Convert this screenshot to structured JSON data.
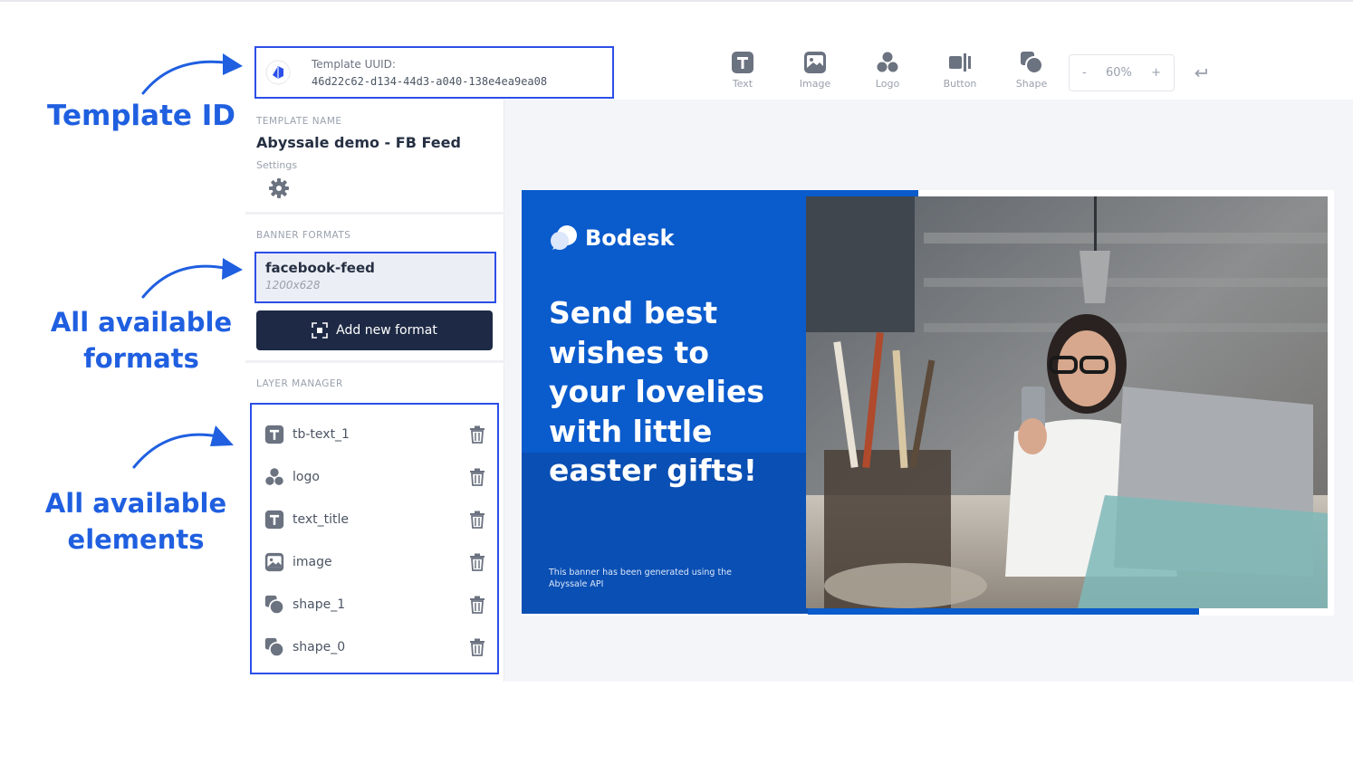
{
  "annotations": {
    "template_id": "Template ID",
    "formats_line1": "All available",
    "formats_line2": "formats",
    "elements_line1": "All available",
    "elements_line2": "elements"
  },
  "uuid": {
    "label": "Template UUID:",
    "value": "46d22c62-d134-44d3-a040-138e4ea9ea08"
  },
  "toolbar": {
    "items": [
      {
        "label": "Text",
        "icon": "text-icon"
      },
      {
        "label": "Image",
        "icon": "image-icon"
      },
      {
        "label": "Logo",
        "icon": "logo-icon"
      },
      {
        "label": "Button",
        "icon": "button-icon"
      },
      {
        "label": "Shape",
        "icon": "shape-icon"
      }
    ],
    "zoom": {
      "minus": "-",
      "value": "60%",
      "plus": "+"
    },
    "undo_icon": "undo-icon"
  },
  "sidebar": {
    "template_name_label": "TEMPLATE NAME",
    "template_name": "Abyssale demo - FB Feed",
    "settings_label": "Settings",
    "banner_formats_label": "BANNER FORMATS",
    "format": {
      "name": "facebook-feed",
      "size": "1200x628"
    },
    "add_format_label": "Add new format",
    "layer_manager_label": "LAYER MANAGER",
    "layers": [
      {
        "name": "tb-text_1",
        "icon": "text-icon"
      },
      {
        "name": "logo",
        "icon": "logo-icon"
      },
      {
        "name": "text_title",
        "icon": "text-icon"
      },
      {
        "name": "image",
        "icon": "image-icon"
      },
      {
        "name": "shape_1",
        "icon": "shape-icon"
      },
      {
        "name": "shape_0",
        "icon": "shape-icon"
      }
    ]
  },
  "banner": {
    "brand": "Bodesk",
    "headline": "Send best wishes to your lovelies with little easter gifts!",
    "footnote": "This banner has been generated using the Abyssale API",
    "colors": {
      "primary": "#0a5bcc",
      "dark": "#0a4fb3"
    }
  },
  "colors": {
    "accent": "#2c4fe8",
    "annotation": "#1f5fe0",
    "button_bg": "#1e2a45"
  }
}
